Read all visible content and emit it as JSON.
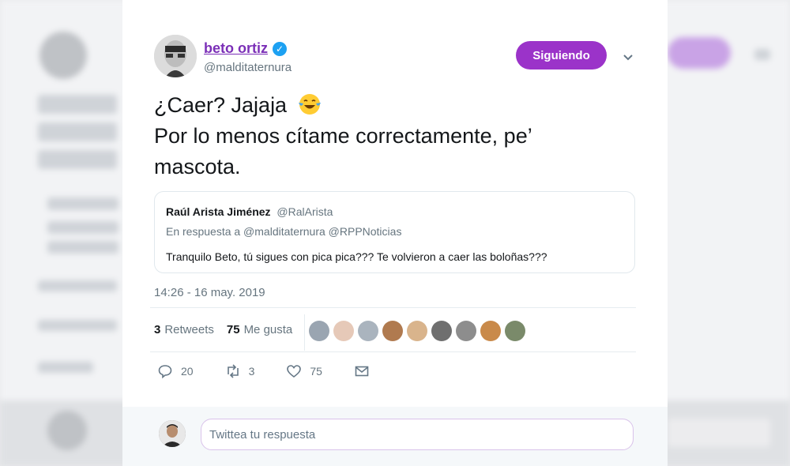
{
  "tweet": {
    "author_name": "beto ortiz",
    "author_handle": "@malditaternura",
    "follow_label": "Siguiendo",
    "text_lines": [
      "¿Caer? Jajaja",
      "Por lo menos cítame correctamente, pe’",
      "mascota."
    ],
    "emoji_icon": "face-with-tears-of-joy-icon",
    "timestamp": "14:26 - 16 may. 2019",
    "retweets_count": "3",
    "retweets_label": "Retweets",
    "likes_count": "75",
    "likes_label": "Me gusta"
  },
  "quoted": {
    "name": "Raúl Arista Jiménez",
    "handle": "@RalArista",
    "reply_to": "En respuesta a @malditaternura @RPPNoticias",
    "text": "Tranquilo Beto, tú sigues con pica pica??? Te volvieron a caer las boloñas???"
  },
  "actions": {
    "replies": "20",
    "retweets": "3",
    "likes": "75"
  },
  "likers": [
    {
      "color": "#9aa5b1"
    },
    {
      "color": "#e6c9b8"
    },
    {
      "color": "#aab4be"
    },
    {
      "color": "#b07a4f"
    },
    {
      "color": "#d9b48c"
    },
    {
      "color": "#6f6f6f"
    },
    {
      "color": "#8d8d8d"
    },
    {
      "color": "#c98a4a"
    },
    {
      "color": "#7a8a6a"
    }
  ],
  "reply_box": {
    "placeholder": "Twittea tu respuesta"
  },
  "colors": {
    "accent": "#9b33c9",
    "verified": "#1da1f2",
    "name": "#7b2fb7"
  }
}
